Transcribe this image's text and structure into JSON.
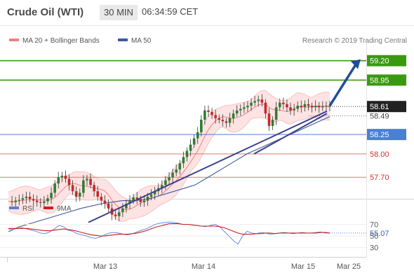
{
  "header": {
    "title": "Crude Oil (WTI)",
    "timeframe": "30 MIN",
    "time": "06:34:59 CET"
  },
  "legend": {
    "ma20": "MA 20 + Bollinger Bands",
    "ma50": "MA 50",
    "credit": "Research © 2019 Trading Central"
  },
  "colors": {
    "candle_up": "#2e7d32",
    "candle_down": "#c62828",
    "ma20": "#f08080",
    "ma50": "#3d5a9e",
    "band_fill": "#fde3e3",
    "resistance": "#3a9a0f",
    "current": "#222222",
    "pivot": "#4a7fd4",
    "support": "#e57373",
    "rsi": "#5b7fd6",
    "rsi_ma": "#cc1f1f",
    "arrow": "#1f4e9a"
  },
  "chart_data": [
    {
      "type": "candlestick",
      "title": "Crude Oil (WTI)",
      "timeframe": "30 MIN",
      "x_ticks": [
        "Mar 13",
        "Mar 14",
        "Mar 15",
        "Mar 25"
      ],
      "ylim": [
        57.45,
        59.35
      ],
      "price_levels": [
        {
          "value": 59.2,
          "label": "59.20",
          "kind": "resistance"
        },
        {
          "value": 58.95,
          "label": "58.95",
          "kind": "resistance"
        },
        {
          "value": 58.61,
          "label": "58.61",
          "kind": "current"
        },
        {
          "value": 58.49,
          "label": "58.49",
          "kind": "pivot-minor"
        },
        {
          "value": 58.25,
          "label": "58.25",
          "kind": "pivot"
        },
        {
          "value": 58.0,
          "label": "58.00",
          "kind": "support"
        },
        {
          "value": 57.7,
          "label": "57.70",
          "kind": "support"
        }
      ],
      "close_series": [
        57.39,
        57.38,
        57.4,
        57.41,
        57.43,
        57.45,
        57.42,
        57.4,
        57.38,
        57.37,
        57.39,
        57.43,
        57.5,
        57.62,
        57.7,
        57.72,
        57.68,
        57.6,
        57.52,
        57.45,
        57.5,
        57.66,
        57.68,
        57.6,
        57.52,
        57.45,
        57.4,
        57.36,
        57.3,
        57.22,
        57.2,
        57.25,
        57.3,
        57.36,
        57.4,
        57.44,
        57.42,
        57.38,
        57.4,
        57.45,
        57.48,
        57.52,
        57.56,
        57.6,
        57.66,
        57.7,
        57.76,
        57.8,
        57.88,
        57.96,
        58.04,
        58.12,
        58.2,
        58.28,
        58.44,
        58.56,
        58.54,
        58.5,
        58.46,
        58.44,
        58.42,
        58.4,
        58.46,
        58.52,
        58.56,
        58.58,
        58.6,
        58.62,
        58.66,
        58.68,
        58.7,
        58.66,
        58.52,
        58.36,
        58.44,
        58.6,
        58.66,
        58.64,
        58.6,
        58.56,
        58.58,
        58.62,
        58.6,
        58.64,
        58.62,
        58.6,
        58.62,
        58.6,
        58.61,
        58.62,
        58.61
      ],
      "ma50_series": [
        57.0,
        57.06,
        57.1,
        57.14,
        57.18,
        57.22,
        57.26,
        57.3,
        57.33,
        57.36,
        57.38,
        57.4,
        57.4,
        57.41,
        57.44,
        57.48,
        57.52,
        57.56,
        57.6,
        57.68,
        57.76,
        57.84,
        57.92,
        58.0,
        58.06,
        58.12,
        58.18,
        58.24,
        58.3,
        58.36,
        58.42,
        58.48
      ],
      "trendlines": [
        {
          "from": [
            "Mar 12",
            57.12
          ],
          "to": [
            "Mar 15",
            58.55
          ]
        },
        {
          "from": [
            "Mar 14",
            58.0
          ],
          "to": [
            "Mar 15",
            58.52
          ]
        }
      ],
      "arrow_target": 59.2
    },
    {
      "type": "line",
      "title": "RSI",
      "series": [
        {
          "name": "RSI",
          "values": [
            62,
            61,
            63,
            64,
            62,
            60,
            58,
            55,
            54,
            57,
            62,
            68,
            66,
            60,
            58,
            54,
            52,
            50,
            47,
            46,
            48,
            52,
            55,
            56,
            55,
            53,
            52,
            54,
            57,
            60,
            62,
            66,
            70,
            72,
            73,
            74,
            73,
            72,
            70,
            70,
            69,
            68,
            67,
            66,
            68,
            70,
            66,
            58,
            50,
            42,
            36,
            50,
            58,
            55,
            54,
            56,
            55,
            53,
            54,
            55,
            56,
            55,
            54,
            55,
            56,
            55,
            55,
            56,
            57,
            55,
            55
          ]
        },
        {
          "name": "9MA",
          "values": [
            63,
            63,
            63,
            63,
            63,
            62,
            61,
            60,
            59,
            59,
            60,
            61,
            62,
            61,
            60,
            58,
            56,
            54,
            52,
            51,
            50,
            50,
            51,
            52,
            53,
            53,
            53,
            54,
            55,
            57,
            59,
            62,
            65,
            67,
            69,
            71,
            71,
            71,
            70,
            70,
            69,
            68,
            67,
            67,
            67,
            67,
            66,
            64,
            61,
            58,
            55,
            53,
            53,
            53,
            54,
            54,
            55,
            55,
            54,
            55,
            55,
            55,
            55,
            55,
            55,
            55,
            55,
            55,
            56,
            56,
            55
          ]
        }
      ],
      "ylim": [
        20,
        85
      ],
      "y_ticks": [
        70,
        50,
        30
      ],
      "current_value": 55.07,
      "current_label": "55.07"
    }
  ],
  "rsi_legend": {
    "rsi": "RSI",
    "ma": "9MA"
  }
}
